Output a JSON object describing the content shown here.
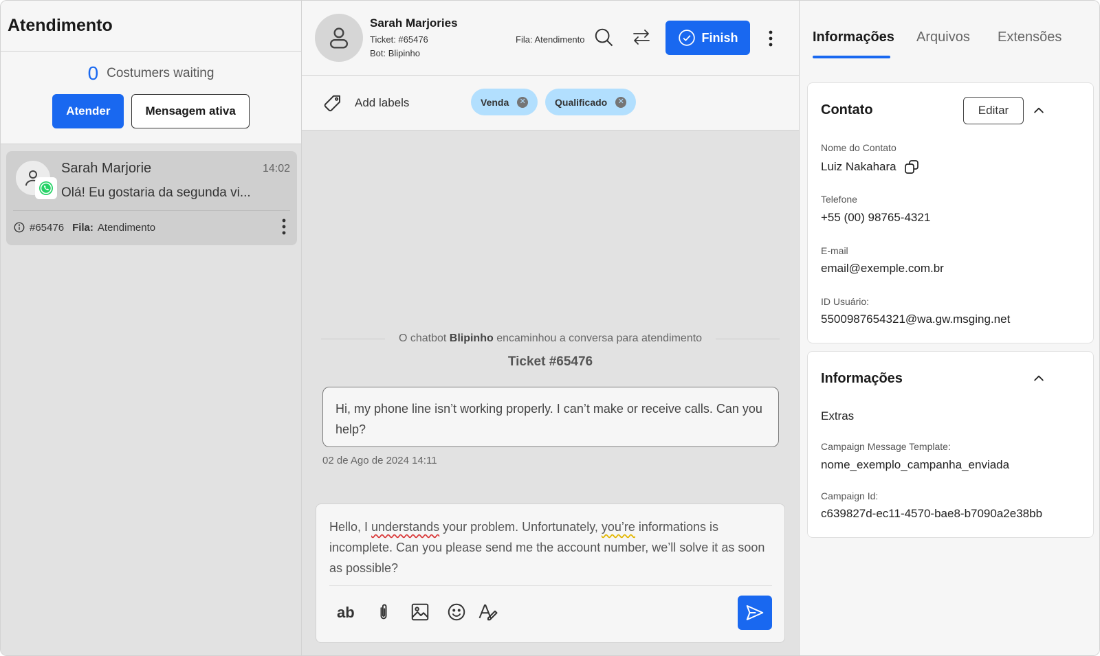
{
  "left": {
    "title": "Atendimento",
    "waiting_count": "0",
    "waiting_label": "Costumers waiting",
    "attend_button": "Atender",
    "active_message_button": "Mensagem ativa",
    "conversation": {
      "name": "Sarah Marjorie",
      "time": "14:02",
      "preview": "Olá! Eu gostaria da segunda vi...",
      "ticket": "#65476",
      "queue_label": "Fila:",
      "queue_value": "Atendimento"
    }
  },
  "header": {
    "name": "Sarah Marjories",
    "ticket": "Ticket: #65476",
    "bot": "Bot: Blipinho",
    "queue": "Fila: Atendimento",
    "finish_button": "Finish"
  },
  "labels": {
    "add_label": "Add labels",
    "chips": [
      "Venda",
      "Qualificado"
    ]
  },
  "chat": {
    "system_prefix": "O chatbot",
    "system_bot": "Blipinho",
    "system_suffix": "encaminhou a conversa para atendimento",
    "ticket_line": "Ticket #65476",
    "message": "Hi, my phone line isn’t working properly. I can’t make or receive calls. Can you help?",
    "message_time": "02 de Ago de 2024 14:11"
  },
  "composer": {
    "part1": "Hello, I ",
    "err1": "understands",
    "part2": " your problem. Unfortunately, ",
    "err2": "you’re",
    "part3": " informations is incomplete. Can you please send me the account number, we’ll solve it as soon as possible?",
    "format_label": "ab"
  },
  "right": {
    "tabs": [
      "Informações",
      "Arquivos",
      "Extensões"
    ],
    "contact": {
      "title": "Contato",
      "edit_button": "Editar",
      "name_label": "Nome do Contato",
      "name_value": "Luiz Nakahara",
      "phone_label": "Telefone",
      "phone_value": "+55 (00) 98765-4321",
      "email_label": "E-mail",
      "email_value": "email@exemple.com.br",
      "id_label": "ID Usuário:",
      "id_value": "5500987654321@wa.gw.msging.net"
    },
    "info": {
      "title": "Informações",
      "extras": "Extras",
      "template_label": "Campaign Message Template:",
      "template_value": "nome_exemplo_campanha_enviada",
      "campaign_label": "Campaign Id:",
      "campaign_value": "c639827d-ec11-4570-bae8-b7090a2e38bb"
    }
  },
  "colors": {
    "primary": "#1968f0",
    "chip": "#b2dffe",
    "whatsapp": "#25d366"
  }
}
